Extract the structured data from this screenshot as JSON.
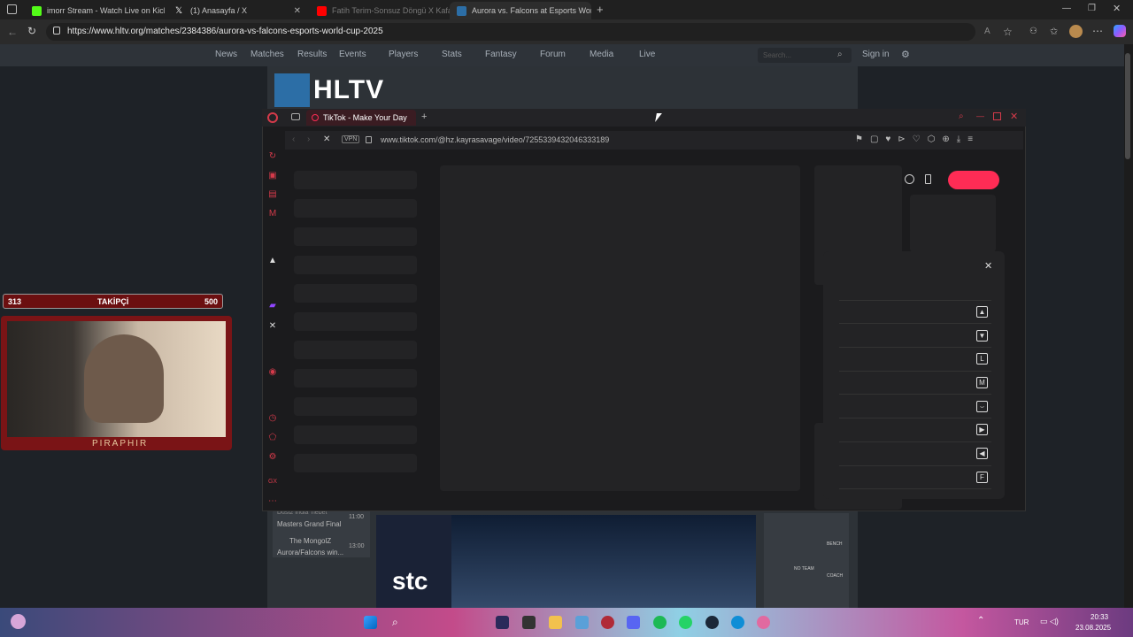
{
  "browser": {
    "tabs": [
      {
        "label": "imorr Stream - Watch Live on Kick",
        "color": "#53fc18"
      },
      {
        "label": "(1) Anasayfa / X",
        "color": "#ffffff"
      },
      {
        "label": "Fatih Terim-Sonsuz Döngü X Kafa",
        "color": "#ff0000"
      },
      {
        "label": "Aurora vs. Falcons at Esports Wor",
        "color": "#2c6ea6"
      }
    ],
    "url": "https://www.hltv.org/matches/2384386/aurora-vs-falcons-esports-world-cup-2025"
  },
  "hltv": {
    "nav": [
      "News",
      "Matches",
      "Results",
      "Events",
      "Players",
      "Stats",
      "Fantasy",
      "Forum",
      "Media",
      "Live"
    ],
    "search_placeholder": "Search...",
    "signin": "Sign in",
    "logo": "HLTV",
    "events": [
      {
        "line1": "Dust2 India Tiebet",
        "line2": "Masters Grand Final",
        "time": "11:00"
      },
      {
        "line1": "The MongolZ",
        "line2": "Aurora/Falcons win...",
        "time": "13:00"
      }
    ],
    "sponsor": "stc",
    "lineup_labels": [
      "BENCH",
      "NO TEAM",
      "COACH"
    ]
  },
  "opera": {
    "tab_title": "TikTok - Make Your Day",
    "vpn": "VPN",
    "url": "www.tiktok.com/@hz.kayrasavage/video/7255339432046333189",
    "menu_keys": [
      "▲",
      "▼",
      "L",
      "M",
      "⌣",
      "▶",
      "◀",
      "F"
    ]
  },
  "stream_overlay": {
    "followers_current": "313",
    "followers_label": "TAKİPÇİ",
    "followers_goal": "500",
    "cam_name": "PIRAPHIR"
  },
  "taskbar": {
    "time": "20:33",
    "date": "23.08.2025",
    "lang": "TUR"
  }
}
